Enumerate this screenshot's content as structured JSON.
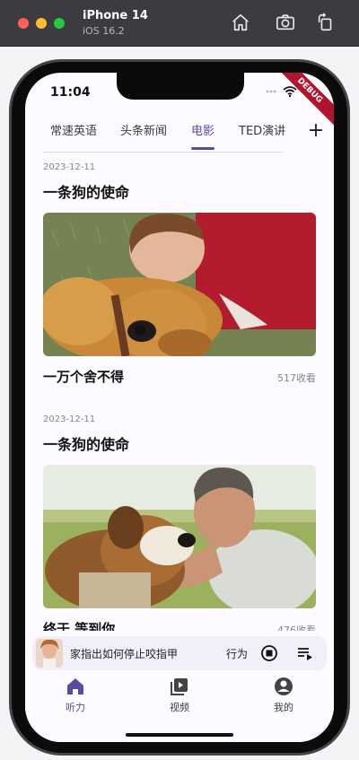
{
  "simulator": {
    "device_name": "iPhone 14",
    "os_version": "iOS 16.2"
  },
  "status_bar": {
    "time": "11:04",
    "debug_banner": "DEBUG"
  },
  "tabs": [
    {
      "label": "常速英语",
      "active": false
    },
    {
      "label": "头条新闻",
      "active": false
    },
    {
      "label": "电影",
      "active": true
    },
    {
      "label": "TED演讲",
      "active": false
    }
  ],
  "add_tab_label": "+",
  "articles": [
    {
      "date": "2023-12-11",
      "title": "一条狗的使命",
      "subtitle": "一万个舍不得",
      "views": "517收看"
    },
    {
      "date": "2023-12-11",
      "title": "一条狗的使命",
      "subtitle": "终于 等到你",
      "views": "476收看"
    }
  ],
  "player": {
    "title": "家指出如何停止咬指甲",
    "next_text": "行为"
  },
  "bottom_nav": [
    {
      "label": "听力",
      "icon": "home-icon",
      "active": true
    },
    {
      "label": "视频",
      "icon": "video-library-icon",
      "active": false
    },
    {
      "label": "我的",
      "icon": "account-circle-icon",
      "active": false
    }
  ],
  "colors": {
    "accent": "#5b4ba0",
    "background": "#fdfbff",
    "player_bg": "#f3effa"
  }
}
